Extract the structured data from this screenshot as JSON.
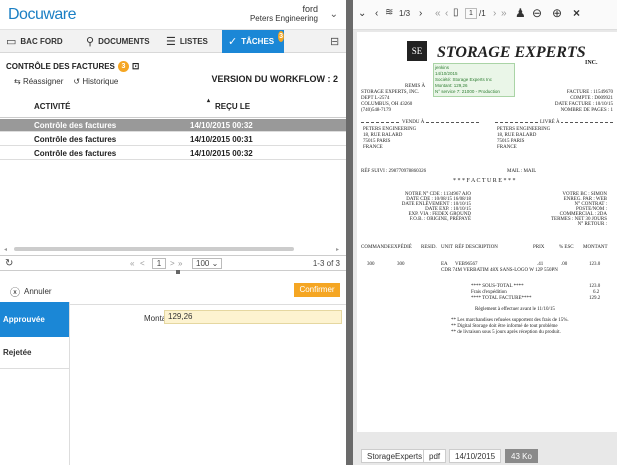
{
  "header": {
    "logo": "Docuware",
    "user_name": "ford",
    "organization": "Peters Engineering"
  },
  "tabs": [
    {
      "label": "BAC FORD",
      "icon": "inbox-icon"
    },
    {
      "label": "DOCUMENTS",
      "icon": "search-icon"
    },
    {
      "label": "LISTES",
      "icon": "list-icon"
    },
    {
      "label": "TÂCHES",
      "icon": "check-icon",
      "badge": "3"
    }
  ],
  "workflow": {
    "title": "CONTRÔLE DES FACTURES",
    "badge": "3",
    "reassign": "Réassigner",
    "history": "Historique",
    "version": "VERSION DU WORKFLOW : 2",
    "columns": [
      "ACTIVITÉ",
      "REÇU LE"
    ],
    "rows": [
      {
        "activity": "Contrôle des factures",
        "received": "14/10/2015 00:32"
      },
      {
        "activity": "Contrôle des factures",
        "received": "14/10/2015 00:31"
      },
      {
        "activity": "Contrôle des factures",
        "received": "14/10/2015 00:32"
      }
    ]
  },
  "pager": {
    "first": "«",
    "prev": "<",
    "page": "1",
    "next": ">",
    "last": "»",
    "page_size": "100",
    "count": "1-3 of 3"
  },
  "form": {
    "cancel": "Annuler",
    "confirm": "Confirmer",
    "options": [
      "Approuvée",
      "Rejetée"
    ],
    "amount_label": "Montant",
    "amount_value": "129,26"
  },
  "viewer": {
    "page_current": "1",
    "page_total_label": "1/3",
    "page_input": "1",
    "page_of": "/1"
  },
  "document": {
    "company_a": "STORAGE EXPERTS",
    "company_b": "INC.",
    "stamp": [
      "jenkins",
      "14/10/2015",
      "Société: Storage Experts Inc",
      "Montant: 129,26",
      "N° service 7: 21000 - Production"
    ],
    "remit_label": "REMIS À",
    "remit": [
      "STORAGE EXPERTS, INC.",
      "DEPT L-2574",
      "COLUMBUS, OH 43260",
      "(740)548-7179"
    ],
    "invoice_meta": [
      "FACTURE : 11549670",
      "COMPTE : D009921",
      "DATE FACTURE : 10/10/15",
      "NOMBRE DE PAGES : 1"
    ],
    "sold_to_label": "VENDU À",
    "delivered_label": "LIVRÉ À",
    "sold_to": [
      "PETERS ENGINEERING",
      "18, RUE BALARD",
      "75015 PARIS",
      "FRANCE"
    ],
    "delivered_to": [
      "PETERS ENGINEERING",
      "18, RUE BALARD",
      "75015 PARIS",
      "FRANCE"
    ],
    "ref": "RÉF SUIVI : 298770978860326",
    "mail": "MAIL : MAIL",
    "heading": "* * * F A C T U R E * * *",
    "order_left": [
      "NOTRE N° CDE : 1134967 AJO",
      "DATE CDE : 10/08/15 16/08/18",
      "DATE ENLÈVEMENT : 10/10/15",
      "DATE EXP. : 10/10/15",
      "EXP. VIA : FEDEX GROUND",
      "F.O.B. : ORIGINE, PRÉPAYÉ"
    ],
    "order_right": [
      "VOTRE BC : SIMON",
      "ENREG. PAR : WEB",
      "N° CONTRAT :",
      "POSTE/NOM :",
      "COMMERCIAL : 2DA",
      "TERMES : NET 30 JOURS",
      "N° RETOUR :"
    ],
    "line_headers": [
      "COMMANDE",
      "EXPÉDIÉ",
      "RESID.",
      "UNIT",
      "RÉF DESCRIPTION",
      "PRIX",
      "% ESC",
      "MONTANT"
    ],
    "line_item": [
      "300",
      "300",
      "EA",
      "VEB96567",
      ".41",
      ".00",
      "123.0"
    ],
    "line_desc": "CDR 74M VERBATIM 48X SANS-LOGO W 12P 550PN",
    "totals": [
      "**** SOUS-TOTAL ****",
      "Frais d'expédition",
      "**** TOTAL FACTURE****"
    ],
    "total_values": [
      "123.0",
      "6.2",
      "129.2"
    ],
    "payment_note": "Règlement à effectuer avant le 11/10/15",
    "footnotes": [
      "** Les marchandises refusées supportent des frais de 15%.",
      "** Digital Storage doit être informé de tout problème",
      "** de livraison sous 5 jours après réception du produit."
    ]
  },
  "bottom_tabs": [
    "StorageExperts",
    "pdf",
    "14/10/2015",
    "43 Ko"
  ],
  "colors": {
    "accent": "#1b87d6",
    "badge": "#f5a623",
    "confirm": "#f5a623",
    "selected_row": "#999999",
    "amount_bg": "#fdf3d0"
  }
}
